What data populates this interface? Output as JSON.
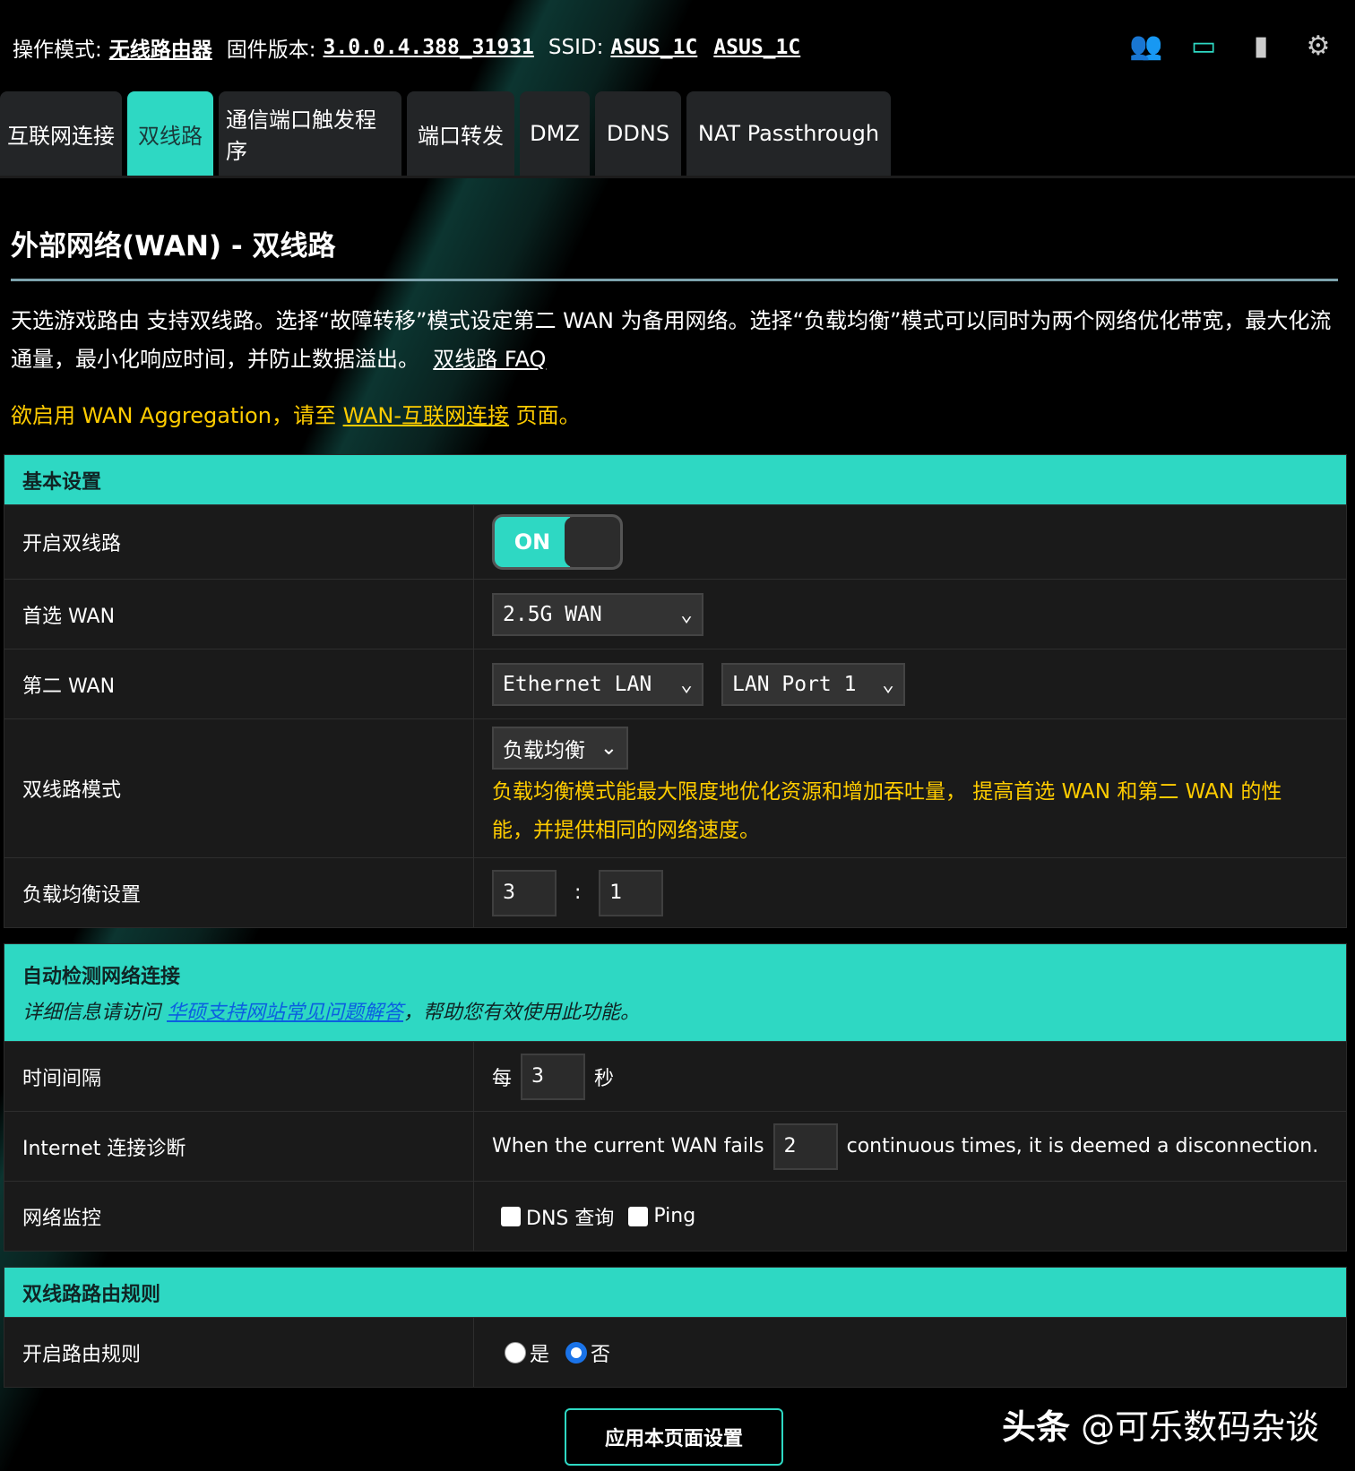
{
  "header": {
    "mode_label": "操作模式:",
    "mode_value": "无线路由器",
    "fw_label": "固件版本:",
    "fw_value": "3.0.0.4.388_31931",
    "ssid_label": "SSID:",
    "ssid1": "ASUS_1C",
    "ssid2": "ASUS_1C",
    "icons": [
      "users-icon",
      "network-clients-icon",
      "usb-icon",
      "settings-gear-icon"
    ]
  },
  "tabs": [
    {
      "label": "互联网连接"
    },
    {
      "label": "双线路",
      "active": true
    },
    {
      "label": "通信端口触发程序"
    },
    {
      "label": "端口转发"
    },
    {
      "label": "DMZ"
    },
    {
      "label": "DDNS"
    },
    {
      "label": "NAT Passthrough"
    }
  ],
  "page": {
    "title": "外部网络(WAN) - 双线路",
    "desc": "天选游戏路由 支持双线路。选择“故障转移”模式设定第二 WAN 为备用网络。选择“负载均衡”模式可以同时为两个网络优化带宽，最大化流通量，最小化响应时间，并防止数据溢出。",
    "faq_link": "双线路 FAQ",
    "agg_pre": "欲启用 WAN Aggregation，请至 ",
    "agg_link": "WAN-互联网连接",
    "agg_post": " 页面。"
  },
  "basic": {
    "title": "基本设置",
    "enable_label": "开启双线路",
    "enable_state": "ON",
    "primary_label": "首选 WAN",
    "primary_value": "2.5G WAN",
    "secondary_label": "第二 WAN",
    "secondary_value": "Ethernet LAN",
    "secondary_port": "LAN Port 1",
    "mode_label": "双线路模式",
    "mode_value": "负载均衡",
    "mode_note": "负载均衡模式能最大限度地优化资源和增加吞吐量， 提高首选 WAN 和第二 WAN 的性能，并提供相同的网络速度。",
    "lb_label": "负载均衡设置",
    "lb_a": "3",
    "lb_sep": ":",
    "lb_b": "1"
  },
  "detect": {
    "title": "自动检测网络连接",
    "info_pre": "详细信息请访问 ",
    "info_link": "华硕支持网站常见问题解答",
    "info_post": "，帮助您有效使用此功能。",
    "interval_label": "时间间隔",
    "interval_pre": "每",
    "interval_value": "3",
    "interval_post": "秒",
    "diag_label": "Internet 连接诊断",
    "diag_pre": "When the current WAN fails",
    "diag_value": "2",
    "diag_post": "continuous times, it is deemed a disconnection.",
    "monitor_label": "网络监控",
    "dns_label": "DNS 查询",
    "ping_label": "Ping"
  },
  "rules": {
    "title": "双线路路由规则",
    "enable_label": "开启路由规则",
    "yes": "是",
    "no": "否",
    "selected": "否"
  },
  "apply_label": "应用本页面设置",
  "watermark": {
    "brand": "头条",
    "account": "@可乐数码杂谈"
  },
  "colors": {
    "accent": "#2ed8c3",
    "warning": "#ffcc00"
  }
}
